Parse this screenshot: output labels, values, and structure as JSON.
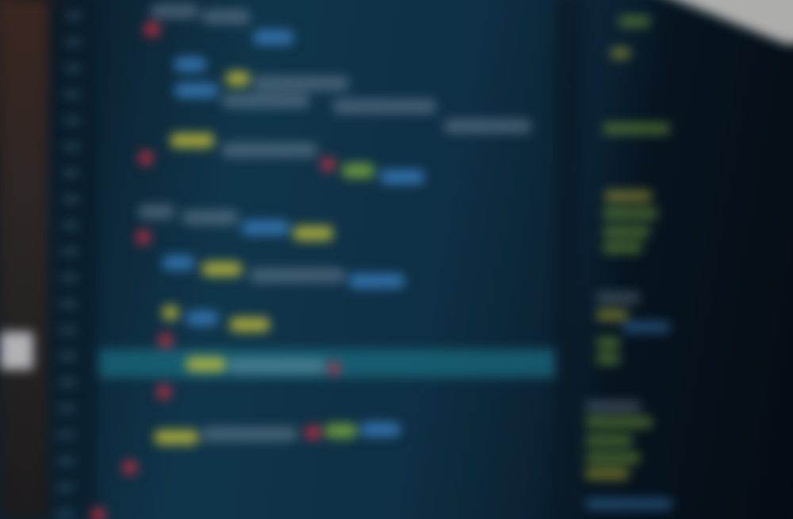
{
  "scene": {
    "subject": "",
    "colors": {
      "background": "#0e2f44",
      "highlight_line": "#1a6a7e",
      "keyword": "#c8c23a",
      "string": "#7fae3c",
      "type": "#3a7fc0",
      "punct": "#c83040",
      "plain": "#a7b8c8",
      "glare": "#e6e3dc"
    }
  }
}
